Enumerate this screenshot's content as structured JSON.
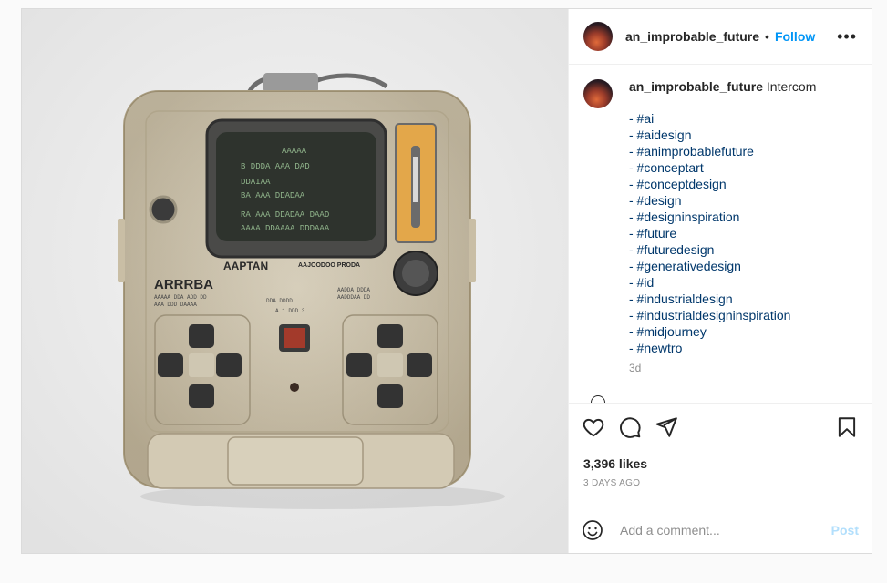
{
  "post": {
    "image_alt": "Weathered beige handheld device with a green-on-black CRT screen and gamepad buttons",
    "device_labels": {
      "left_brand": "ARRRBA",
      "center_brand": "AAPTAN",
      "right_label": "AAJOODOO PRODA"
    }
  },
  "header": {
    "username": "an_improbable_future",
    "separator": "•",
    "follow_label": "Follow",
    "more_label": "•••"
  },
  "caption": {
    "username": "an_improbable_future",
    "text": "Intercom",
    "hashtags": [
      "- #ai",
      "- #aidesign",
      "- #animprobablefuture",
      "- #conceptart",
      "- #conceptdesign",
      "- #design",
      "- #designinspiration",
      "- #future",
      "- #futuredesign",
      "- #generativedesign",
      "- #id",
      "- #industrialdesign",
      "- #industrialdesigninspiration",
      "- #midjourney",
      "- #newtro"
    ],
    "age": "3d"
  },
  "engagement": {
    "likes": "3,396 likes",
    "date": "3 DAYS AGO"
  },
  "comment_box": {
    "placeholder": "Add a comment...",
    "post_label": "Post"
  },
  "icons": {
    "like": "heart-icon",
    "comment": "comment-bubble-icon",
    "share": "paper-plane-icon",
    "save": "bookmark-icon",
    "emoji": "smiley-icon"
  },
  "colors": {
    "accent": "#0095f6",
    "post_disabled": "#b2dffc",
    "hashtag": "#00376b",
    "muted": "#8e8e8e"
  }
}
